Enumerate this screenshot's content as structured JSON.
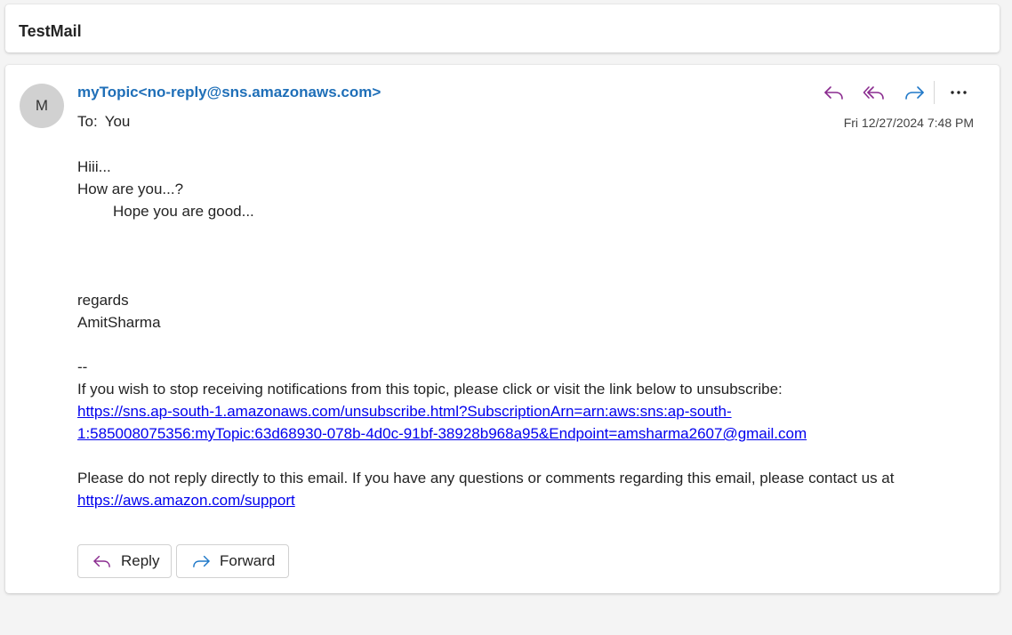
{
  "subject": "TestMail",
  "sender": {
    "avatar_initial": "M",
    "display": "myTopic<no-reply@sns.amazonaws.com>"
  },
  "recipients": {
    "label": "To:",
    "value": "You"
  },
  "date": "Fri 12/27/2024 7:48 PM",
  "actions": {
    "reply": "reply-icon",
    "reply_all": "reply-all-icon",
    "forward": "forward-icon",
    "more": "more-icon"
  },
  "body": {
    "line1": "Hiii...",
    "line2": "How are you...?",
    "line3": "Hope you are good...",
    "regards": "regards",
    "signature": "AmitSharma",
    "separator": "--",
    "unsub_text": "If you wish to stop receiving notifications from this topic, please click or visit the link below to unsubscribe:",
    "unsub_link_line1": "https://sns.ap-south-1.amazonaws.com/unsubscribe.html?SubscriptionArn=arn:aws:sns:ap-south-",
    "unsub_link_line2": "1:585008075356:myTopic:63d68930-078b-4d0c-91bf-38928b968a95&Endpoint=amsharma2607@gmail.com",
    "notice": "Please do not reply directly to this email. If you have any questions or comments regarding this email, please contact us at",
    "support_link": "https://aws.amazon.com/support"
  },
  "buttons": {
    "reply": "Reply",
    "forward": "Forward"
  },
  "colors": {
    "sender": "#1f6fb8",
    "reply_icon": "#8a2b8f",
    "forward_icon": "#1f78c8",
    "link": "#0000ee"
  }
}
